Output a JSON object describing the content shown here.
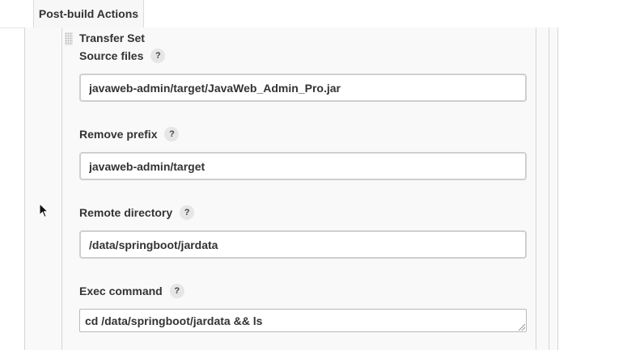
{
  "tab": {
    "label": "Post-build Actions"
  },
  "transfer_set": {
    "title": "Transfer Set",
    "help_label": "?",
    "source_files": {
      "label": "Source files",
      "value": "javaweb-admin/target/JavaWeb_Admin_Pro.jar"
    },
    "remove_prefix": {
      "label": "Remove prefix",
      "value": "javaweb-admin/target"
    },
    "remote_directory": {
      "label": "Remote directory",
      "value": "/data/springboot/jardata"
    },
    "exec_command": {
      "label": "Exec command",
      "value": "cd /data/springboot/jardata && ls"
    }
  },
  "colors": {
    "panel_bg": "#f9f9f9",
    "border": "#d6d6d6",
    "text": "#333333"
  },
  "icons": {
    "drag": "drag-handle-icon",
    "help": "help-icon",
    "cursor": "mouse-pointer-icon"
  }
}
